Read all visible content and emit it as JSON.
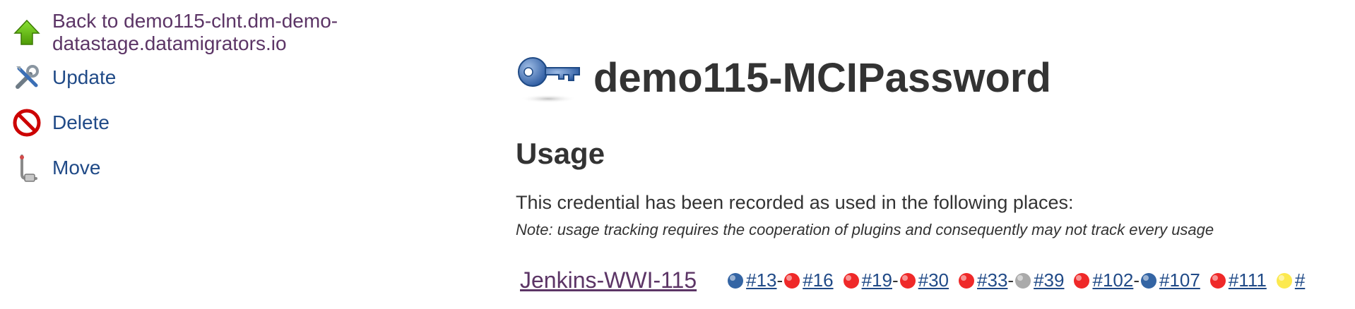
{
  "sidebar": {
    "items": [
      {
        "label": "Back to demo115-clnt.dm-demo-datastage.datamigrators.io",
        "icon": "up-arrow-icon"
      },
      {
        "label": "Update",
        "icon": "wrench-screwdriver-icon"
      },
      {
        "label": "Delete",
        "icon": "no-entry-icon"
      },
      {
        "label": "Move",
        "icon": "move-icon"
      }
    ]
  },
  "main": {
    "title": "demo115-MCIPassword",
    "title_icon": "key-icon",
    "section_title": "Usage",
    "description": "This credential has been recorded as used in the following places:",
    "note": "Note: usage tracking requires the cooperation of plugins and consequently may not track every usage",
    "usage": {
      "job": "Jenkins-WWI-115",
      "builds": [
        {
          "start": {
            "label": "#13",
            "status": "blue"
          },
          "end": {
            "label": "#16",
            "status": "red"
          }
        },
        {
          "start": {
            "label": "#19",
            "status": "red"
          },
          "end": {
            "label": "#30",
            "status": "red"
          }
        },
        {
          "start": {
            "label": "#33",
            "status": "red"
          },
          "end": {
            "label": "#39",
            "status": "grey"
          }
        },
        {
          "start": {
            "label": "#102",
            "status": "red"
          },
          "end": {
            "label": "#107",
            "status": "blue"
          }
        },
        {
          "start": {
            "label": "#111",
            "status": "red"
          },
          "end": null
        },
        {
          "start": {
            "label": "#",
            "status": "yellow"
          },
          "end": null
        }
      ]
    }
  },
  "colors": {
    "link": "#204a87",
    "visited_link": "#5c3566",
    "text": "#333333",
    "ball_blue": "#3465a4",
    "ball_red": "#ef2929",
    "ball_grey": "#aaaaaa",
    "ball_yellow": "#fce94f"
  }
}
